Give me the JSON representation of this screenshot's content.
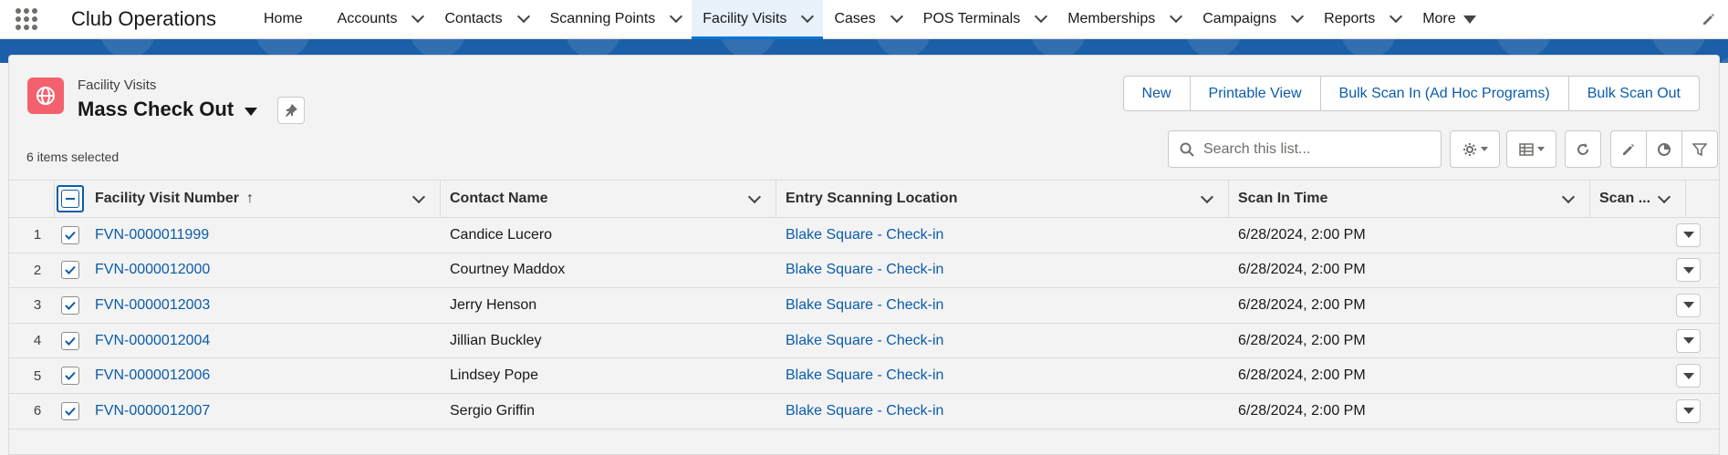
{
  "app": {
    "name": "Club Operations"
  },
  "nav": {
    "items": [
      {
        "label": "Home",
        "dropdown": false,
        "active": false
      },
      {
        "label": "Accounts",
        "dropdown": true,
        "active": false
      },
      {
        "label": "Contacts",
        "dropdown": true,
        "active": false
      },
      {
        "label": "Scanning Points",
        "dropdown": true,
        "active": false
      },
      {
        "label": "Facility Visits",
        "dropdown": true,
        "active": true
      },
      {
        "label": "Cases",
        "dropdown": true,
        "active": false
      },
      {
        "label": "POS Terminals",
        "dropdown": true,
        "active": false
      },
      {
        "label": "Memberships",
        "dropdown": true,
        "active": false
      },
      {
        "label": "Campaigns",
        "dropdown": true,
        "active": false
      },
      {
        "label": "Reports",
        "dropdown": true,
        "active": false
      },
      {
        "label": "More",
        "dropdown": true,
        "active": false
      }
    ]
  },
  "header": {
    "object_label": "Facility Visits",
    "list_view_name": "Mass Check Out",
    "selected_info": "6 items selected",
    "icon_color": "#f4616e"
  },
  "actions": {
    "new": "New",
    "printable": "Printable View",
    "bulk_in": "Bulk Scan In (Ad Hoc Programs)",
    "bulk_out": "Bulk Scan Out"
  },
  "search": {
    "placeholder": "Search this list..."
  },
  "table": {
    "columns": [
      {
        "label": "Facility Visit Number",
        "sort": "↑"
      },
      {
        "label": "Contact Name"
      },
      {
        "label": "Entry Scanning Location"
      },
      {
        "label": "Scan In Time"
      },
      {
        "label": "Scan ..."
      }
    ],
    "rows": [
      {
        "num": "1",
        "visit": "FVN-0000011999",
        "contact": "Candice Lucero",
        "location": "Blake Square - Check-in",
        "time": "6/28/2024, 2:00 PM"
      },
      {
        "num": "2",
        "visit": "FVN-0000012000",
        "contact": "Courtney Maddox",
        "location": "Blake Square - Check-in",
        "time": "6/28/2024, 2:00 PM"
      },
      {
        "num": "3",
        "visit": "FVN-0000012003",
        "contact": "Jerry Henson",
        "location": "Blake Square - Check-in",
        "time": "6/28/2024, 2:00 PM"
      },
      {
        "num": "4",
        "visit": "FVN-0000012004",
        "contact": "Jillian Buckley",
        "location": "Blake Square - Check-in",
        "time": "6/28/2024, 2:00 PM"
      },
      {
        "num": "5",
        "visit": "FVN-0000012006",
        "contact": "Lindsey Pope",
        "location": "Blake Square - Check-in",
        "time": "6/28/2024, 2:00 PM"
      },
      {
        "num": "6",
        "visit": "FVN-0000012007",
        "contact": "Sergio Griffin",
        "location": "Blake Square - Check-in",
        "time": "6/28/2024, 2:00 PM"
      }
    ]
  },
  "colors": {
    "brand": "#0176d3",
    "link": "#0b5cab",
    "band": "#1b5fa8"
  }
}
